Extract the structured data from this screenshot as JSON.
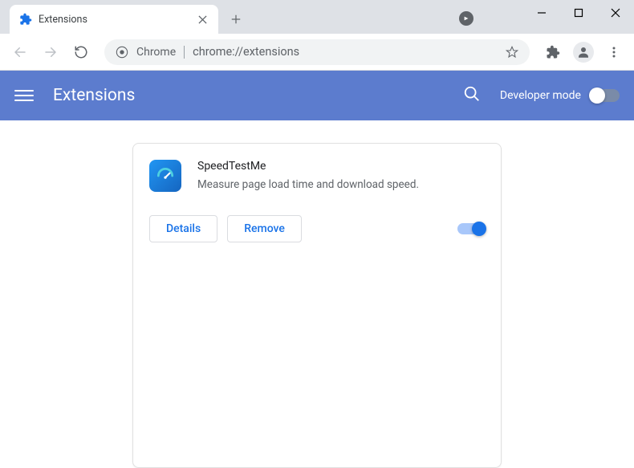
{
  "window": {
    "tab_title": "Extensions"
  },
  "toolbar": {
    "origin_label": "Chrome",
    "url": "chrome://extensions"
  },
  "header": {
    "title": "Extensions",
    "dev_mode_label": "Developer mode"
  },
  "extension": {
    "name": "SpeedTestMe",
    "description": "Measure page load time and download speed.",
    "details_label": "Details",
    "remove_label": "Remove"
  }
}
